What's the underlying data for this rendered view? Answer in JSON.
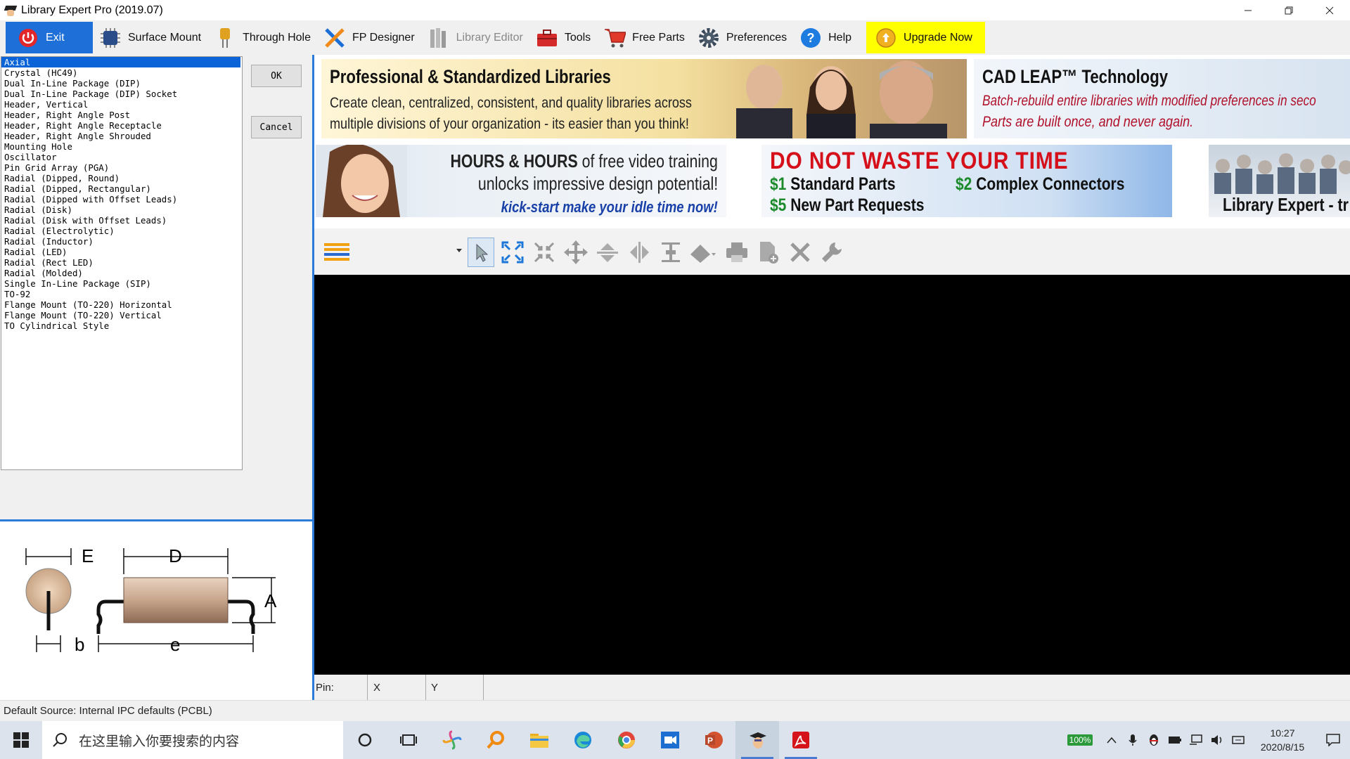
{
  "window": {
    "title": "Library Expert Pro (2019.07)"
  },
  "toolbar": {
    "items": [
      {
        "label": "Exit",
        "icon": "power-icon"
      },
      {
        "label": "Surface Mount",
        "icon": "chip-icon"
      },
      {
        "label": "Through Hole",
        "icon": "through-hole-component-icon"
      },
      {
        "label": "FP Designer",
        "icon": "designer-tools-icon"
      },
      {
        "label": "Library Editor",
        "icon": "library-books-icon"
      },
      {
        "label": "Tools",
        "icon": "toolbox-icon"
      },
      {
        "label": "Free Parts",
        "icon": "shopping-cart-icon"
      },
      {
        "label": "Preferences",
        "icon": "gear-icon"
      },
      {
        "label": "Help",
        "icon": "help-icon"
      },
      {
        "label": "Upgrade Now",
        "icon": "upgrade-icon"
      }
    ]
  },
  "package_list": {
    "selected_index": 0,
    "items": [
      "Axial",
      "Crystal (HC49)",
      "Dual In-Line Package (DIP)",
      "Dual In-Line Package (DIP) Socket",
      "Header, Vertical",
      "Header, Right Angle Post",
      "Header, Right Angle Receptacle",
      "Header, Right Angle Shrouded",
      "Mounting Hole",
      "Oscillator",
      "Pin Grid Array (PGA)",
      "Radial (Dipped, Round)",
      "Radial (Dipped, Rectangular)",
      "Radial (Dipped with Offset Leads)",
      "Radial (Disk)",
      "Radial (Disk with Offset Leads)",
      "Radial (Electrolytic)",
      "Radial (Inductor)",
      "Radial (LED)",
      "Radial (Rect LED)",
      "Radial (Molded)",
      "Single In-Line Package (SIP)",
      "TO-92",
      "Flange Mount (TO-220) Horizontal",
      "Flange Mount (TO-220) Vertical",
      "TO Cylindrical Style"
    ]
  },
  "dialog": {
    "ok_label": "OK",
    "cancel_label": "Cancel"
  },
  "dimension_diagram": {
    "E": "E",
    "D": "D",
    "A": "A",
    "b": "b",
    "e": "e"
  },
  "ads": {
    "ad1": {
      "title": "Professional & Standardized Libraries",
      "body": "Create clean, centralized, consistent, and quality libraries across multiple divisions of your organization - its easier than you think!"
    },
    "ad2": {
      "title": "CAD LEAP™ Technology",
      "line1": "Batch-rebuild entire libraries with modified preferences in seco",
      "line2": "Parts are built once, and never again."
    },
    "ad3": {
      "title_bold": "HOURS & HOURS",
      "title_rest": " of free video training",
      "line2": "unlocks impressive design potential!",
      "line3": "kick-start make your idle time now!"
    },
    "ad4": {
      "title": "DO NOT WASTE YOUR TIME",
      "p1_price": "$1",
      "p1_label": " Standard Parts",
      "p2_price": "$2",
      "p2_label": " Complex Connectors",
      "p3_price": "$5",
      "p3_label": " New Part Requests"
    },
    "ad5": {
      "title": "Library Expert - tr"
    }
  },
  "canvas_toolbar": {
    "combo_value": "",
    "icons": [
      "select-arrow-icon",
      "zoom-extents-icon",
      "zoom-fit-icon",
      "pan-move-icon",
      "flip-vertical-icon",
      "flip-horizontal-icon",
      "center-align-icon",
      "fill-shape-icon",
      "print-icon",
      "add-document-icon",
      "delete-icon",
      "wrench-icon"
    ]
  },
  "coords": {
    "pin_label": "Pin:",
    "x_label": "X",
    "y_label": "Y"
  },
  "status": {
    "text": "Default Source:  Internal IPC defaults (PCBL)"
  },
  "taskbar": {
    "search_placeholder": "在这里输入你要搜索的内容",
    "battery": "100%",
    "time": "10:27",
    "date": "2020/8/15"
  },
  "colors": {
    "accent_blue": "#1f6fd8",
    "upgrade_yellow": "#ffff00",
    "ad_red": "#d6101a"
  }
}
